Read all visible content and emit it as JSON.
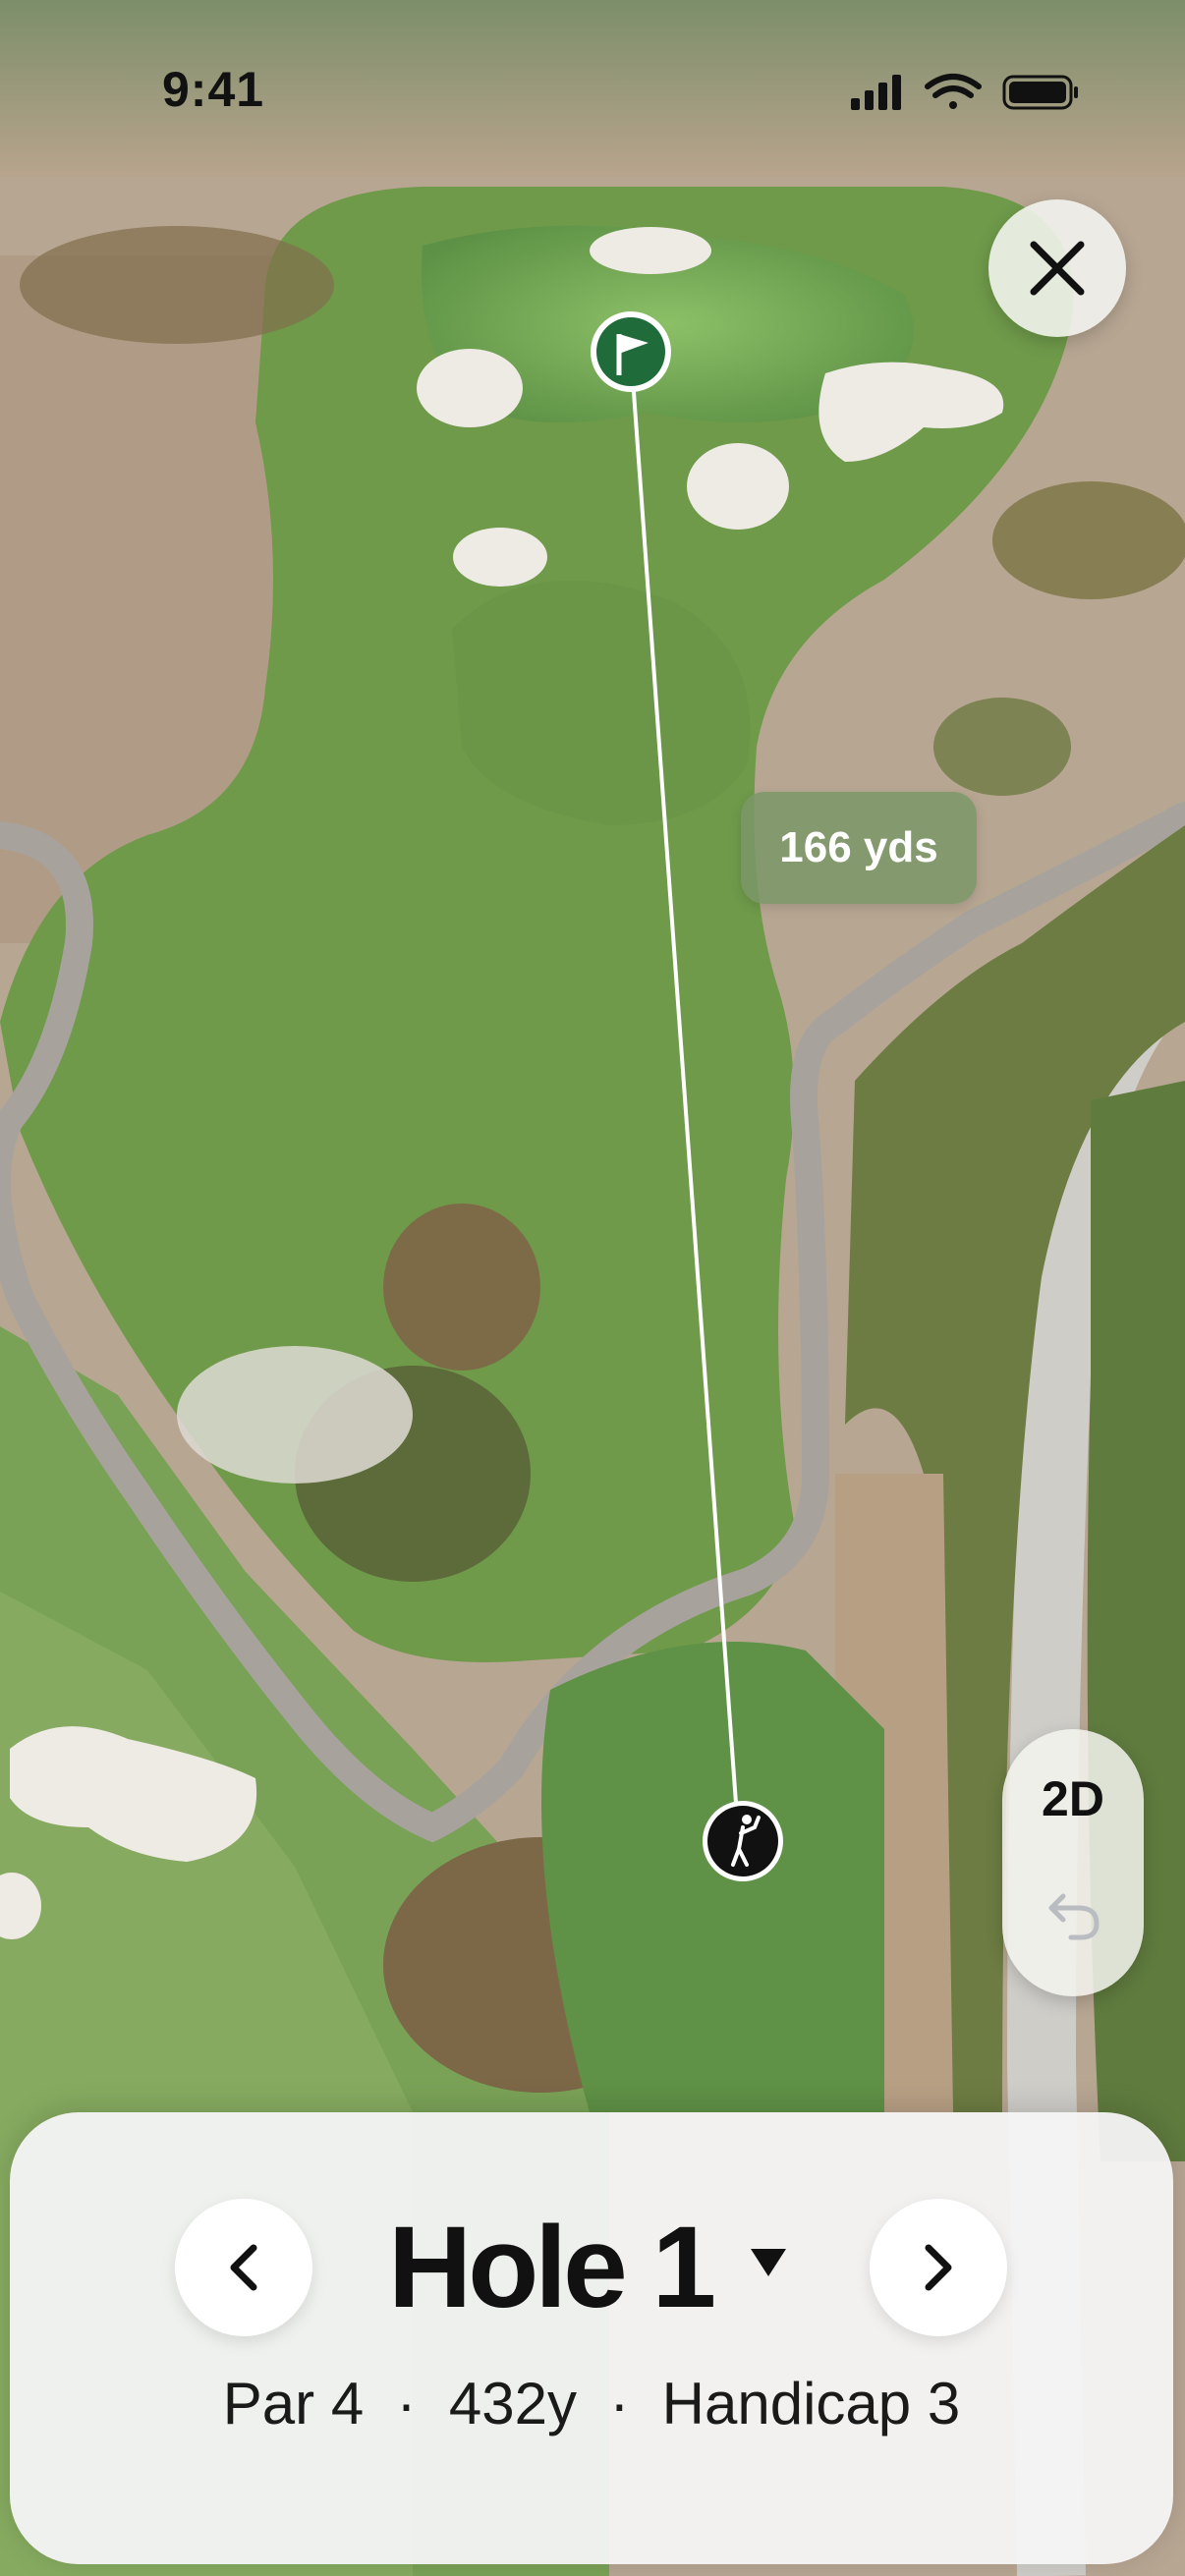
{
  "status_bar": {
    "time": "9:41"
  },
  "map": {
    "distance_label": "166 yds",
    "pin_icon": "flag-icon",
    "player_icon": "golfer-icon"
  },
  "controls": {
    "close_icon": "close-icon",
    "view_mode": "2D",
    "undo_icon": "undo-icon"
  },
  "hole_panel": {
    "title": "Hole 1",
    "par": "Par 4",
    "yardage": "432y",
    "handicap": "Handicap 3",
    "separator": "·",
    "prev_icon": "chevron-left-icon",
    "next_icon": "chevron-right-icon",
    "dropdown_icon": "caret-down-icon"
  },
  "colors": {
    "fairway": "#6f9a4a",
    "green": "#7fb15a",
    "rough": "#b9a793",
    "pin": "#1f6b3a",
    "player": "#111111"
  }
}
